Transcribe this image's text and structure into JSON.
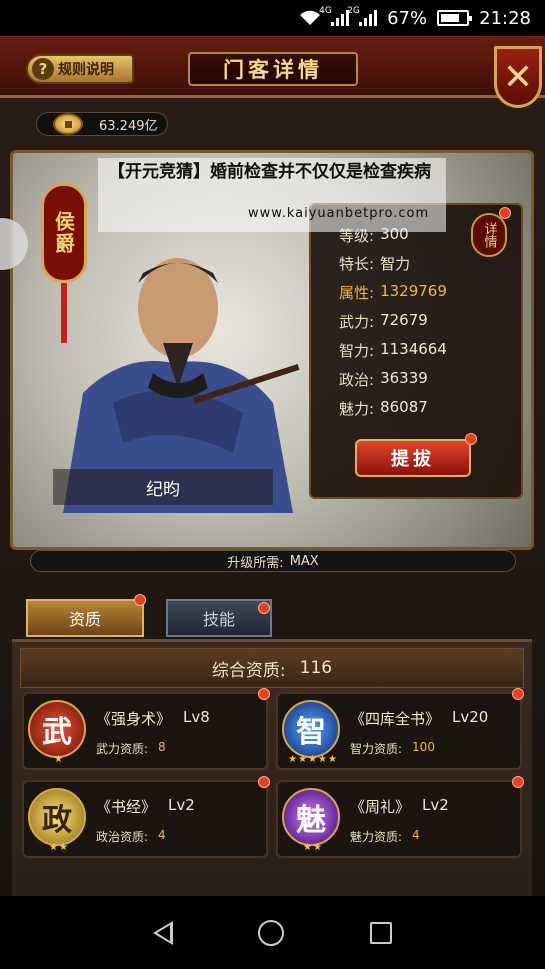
{
  "status_bar": {
    "network1": "4G",
    "network2": "2G",
    "battery_percent": "67%",
    "battery_level": 0.67,
    "time": "21:28"
  },
  "header": {
    "rules_label": "规则说明",
    "title": "门客详情",
    "close_label": "✕"
  },
  "currency": {
    "value": "63.249亿"
  },
  "hero": {
    "seal_text": "侯爵",
    "name": "纪昀",
    "detail_label": "详情",
    "stats": [
      {
        "label": "等级:",
        "value": "300"
      },
      {
        "label": "特长:",
        "value": "智力"
      },
      {
        "label": "属性:",
        "value": "1329769"
      },
      {
        "label": "武力:",
        "value": "72679"
      },
      {
        "label": "智力:",
        "value": "1134664"
      },
      {
        "label": "政治:",
        "value": "36339"
      },
      {
        "label": "魅力:",
        "value": "86087"
      }
    ],
    "promote_label": "提拔",
    "upgrade_label": "升级所需:",
    "upgrade_value": "MAX"
  },
  "tabs": {
    "active": "资质",
    "inactive": "技能"
  },
  "talent": {
    "header_label": "综合资质:",
    "header_value": "116",
    "cards": [
      {
        "glyph": "武",
        "title": "《强身术》",
        "level": "Lv8",
        "attr_label": "武力资质:",
        "attr_value": "8",
        "stars": "★",
        "color": "#c0241a"
      },
      {
        "glyph": "智",
        "title": "《四库全书》",
        "level": "Lv20",
        "attr_label": "智力资质:",
        "attr_value": "100",
        "stars": "★★★★★",
        "color": "#1e5fbf"
      },
      {
        "glyph": "政",
        "title": "《书经》",
        "level": "Lv2",
        "attr_label": "政治资质:",
        "attr_value": "4",
        "stars": "★★",
        "color": "#c9a11c"
      },
      {
        "glyph": "魅",
        "title": "《周礼》",
        "level": "Lv2",
        "attr_label": "魅力资质:",
        "attr_value": "4",
        "stars": "★★",
        "color": "#8a2bc9"
      }
    ]
  },
  "ad_overlay": {
    "title": "【开元竞猜】婚前检查并不仅仅是检查疾病",
    "url": "www.kaiyuanbetpro.com"
  }
}
